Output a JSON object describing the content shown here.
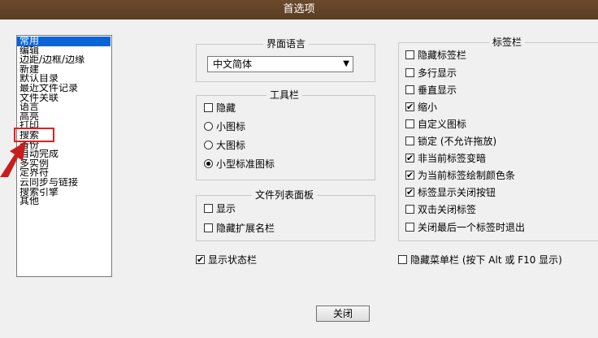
{
  "window": {
    "title": "首选项"
  },
  "category_list": {
    "items": [
      "常用",
      "编辑",
      "边距/边框/边缘",
      "新建",
      "默认目录",
      "最近文件记录",
      "文件关联",
      "语言",
      "高亮",
      "打印",
      "搜索",
      "备份",
      "自动完成",
      "多实例",
      "定界符",
      "云同步与链接",
      "搜索引擎",
      "其他"
    ],
    "selected": "常用"
  },
  "ui_language": {
    "title": "界面语言",
    "selected": "中文简体"
  },
  "toolbar": {
    "title": "工具栏",
    "hide_label": "隐藏",
    "hide_checked": false,
    "options": [
      {
        "label": "小图标",
        "checked": false
      },
      {
        "label": "大图标",
        "checked": false
      },
      {
        "label": "小型标准图标",
        "checked": true
      }
    ]
  },
  "doc_list_panel": {
    "title": "文件列表面板",
    "show_label": "显示",
    "show_checked": false,
    "hide_ext_label": "隐藏扩展名栏",
    "hide_ext_checked": false
  },
  "status_bar": {
    "label": "显示状态栏",
    "checked": true
  },
  "tab_bar": {
    "title": "标签栏",
    "options": [
      {
        "label": "隐藏标签栏",
        "checked": false
      },
      {
        "label": "多行显示",
        "checked": false
      },
      {
        "label": "垂直显示",
        "checked": false
      },
      {
        "label": "缩小",
        "checked": true
      },
      {
        "label": "自定义图标",
        "checked": false
      },
      {
        "label": "锁定 (不允许拖放)",
        "checked": false
      },
      {
        "label": "非当前标签变暗",
        "checked": true
      },
      {
        "label": "为当前标签绘制颜色条",
        "checked": true
      },
      {
        "label": "标签显示关闭按钮",
        "checked": true
      },
      {
        "label": "双击关闭标签",
        "checked": false
      },
      {
        "label": "关闭最后一个标签时退出",
        "checked": false
      }
    ]
  },
  "menu_bar": {
    "label": "隐藏菜单栏 (按下 Alt 或 F10 显示)",
    "checked": false
  },
  "buttons": {
    "close": "关闭"
  },
  "colors": {
    "titlebar": "#5f4127",
    "selection": "#0a64d8",
    "annotation": "#e02020"
  }
}
